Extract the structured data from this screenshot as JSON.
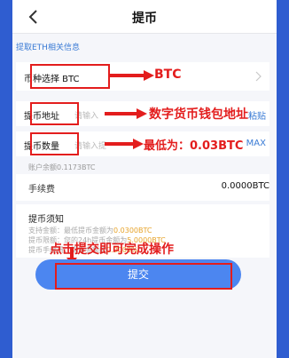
{
  "header": {
    "title": "提币",
    "back_icon": "back-chevron"
  },
  "hint": "提取ETH相关信息",
  "currency": {
    "label": "币种选择 BTC",
    "annotation": "BTC"
  },
  "address": {
    "label": "提币地址",
    "placeholder": "请输入",
    "paste": "粘贴",
    "annotation": "数字货币钱包地址"
  },
  "amount": {
    "label": "提币数量",
    "placeholder": "请输入提",
    "max": "MAX",
    "annotation": "最低为：0.03BTC"
  },
  "balance": "账户余额0.1173BTC",
  "fee": {
    "label": "手续费",
    "value": "0.0000BTC"
  },
  "notice": {
    "title": "提币须知",
    "lines": [
      {
        "text": "支持金额：最低提币金额为",
        "em": "0.0300BTC"
      },
      {
        "text": "提币限额：您的24h提币金额为",
        "em": "5.0000BTC"
      },
      {
        "text": "提币手续费：提币金额的",
        "em": "0.0000%"
      }
    ]
  },
  "submit_annotation": "点击提交即可完成操作",
  "submit_label": "提交",
  "colors": {
    "accent": "#4c86f0",
    "annotation": "#e31d1d",
    "frame": "#2f5dd0"
  }
}
